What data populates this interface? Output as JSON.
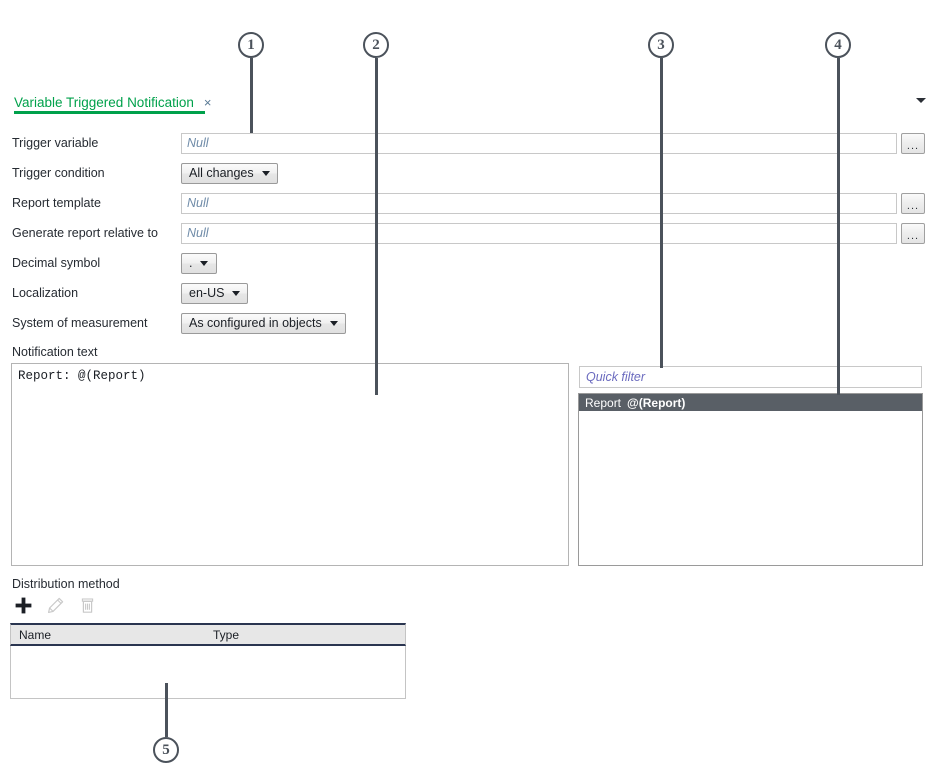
{
  "tab": {
    "label": "Variable Triggered Notification",
    "close_icon": "×",
    "overflow_icon": "chevron-down-icon"
  },
  "form": {
    "rows": [
      {
        "label": "Trigger variable",
        "kind": "text",
        "value": "Null",
        "button": "..."
      },
      {
        "label": "Trigger condition",
        "kind": "combo",
        "value": "All changes"
      },
      {
        "label": "Report template",
        "kind": "text",
        "value": "Null",
        "button": "..."
      },
      {
        "label": "Generate report relative to",
        "kind": "text",
        "value": "Null",
        "button": "..."
      },
      {
        "label": "Decimal symbol",
        "kind": "combo",
        "value": "."
      },
      {
        "label": "Localization",
        "kind": "combo",
        "value": "en-US"
      },
      {
        "label": "System of measurement",
        "kind": "combo",
        "value": "As configured in objects"
      }
    ]
  },
  "notification": {
    "section_label": "Notification text",
    "text": "Report: @(Report)"
  },
  "tokens": {
    "filter_placeholder": "Quick filter",
    "items": [
      {
        "name": "Report",
        "value": "@(Report)",
        "selected": true
      }
    ]
  },
  "distribution": {
    "section_label": "Distribution method",
    "toolbar": [
      {
        "icon": "add-icon",
        "enabled": true
      },
      {
        "icon": "edit-icon",
        "enabled": false
      },
      {
        "icon": "delete-icon",
        "enabled": false
      }
    ],
    "columns": [
      "Name",
      "Type"
    ],
    "rows": []
  },
  "callouts": [
    {
      "number": "1"
    },
    {
      "number": "2"
    },
    {
      "number": "3"
    },
    {
      "number": "4"
    },
    {
      "number": "5"
    }
  ],
  "colors": {
    "accent_green": "#00a14b",
    "selection_gray": "#595f66",
    "header_navy": "#2a3550",
    "placeholder_blue": "#6f8ba8",
    "filter_violet": "#6b6bbf",
    "callout_gray": "#4b525b"
  }
}
